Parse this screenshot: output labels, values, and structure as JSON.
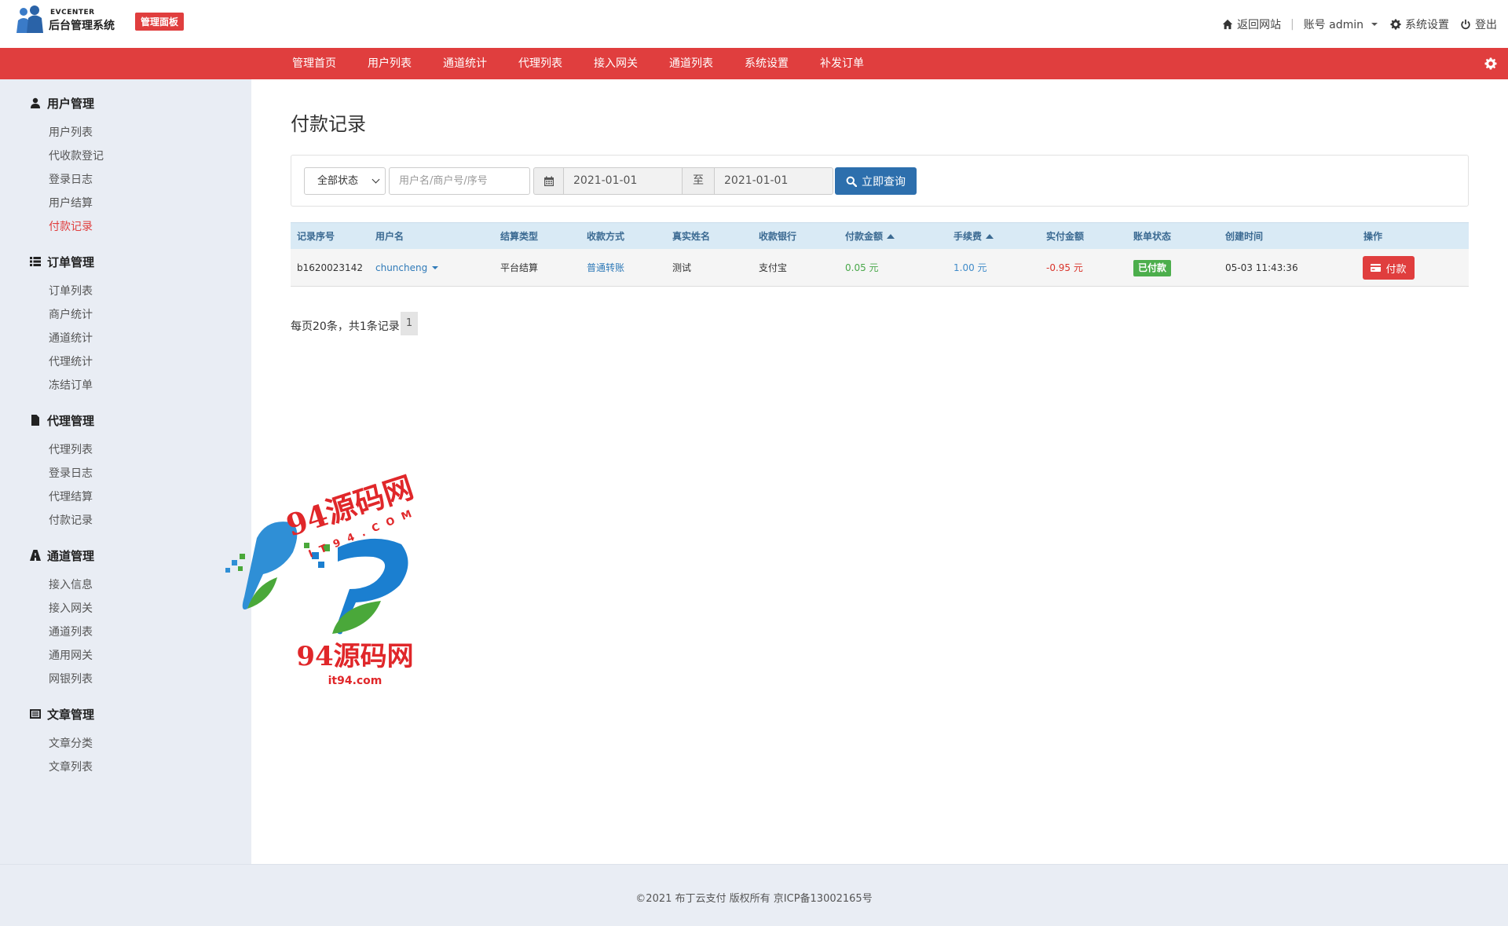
{
  "header": {
    "logo_small": "EVCENTER",
    "logo_big": "后台管理系统",
    "panel_badge": "管理面板",
    "back_site": "返回网站",
    "account": "账号 admin",
    "settings": "系统设置",
    "logout": "登出"
  },
  "nav": {
    "items": [
      "管理首页",
      "用户列表",
      "通道统计",
      "代理列表",
      "接入网关",
      "通道列表",
      "系统设置",
      "补发订单"
    ]
  },
  "sidebar": {
    "groups": [
      {
        "title": "用户管理",
        "icon": "user-icon",
        "items": [
          "用户列表",
          "代收款登记",
          "登录日志",
          "用户结算",
          "付款记录"
        ]
      },
      {
        "title": "订单管理",
        "icon": "list-icon",
        "items": [
          "订单列表",
          "商户统计",
          "通道统计",
          "代理统计",
          "冻结订单"
        ]
      },
      {
        "title": "代理管理",
        "icon": "file-icon",
        "items": [
          "代理列表",
          "登录日志",
          "代理结算",
          "付款记录"
        ]
      },
      {
        "title": "通道管理",
        "icon": "road-icon",
        "items": [
          "接入信息",
          "接入网关",
          "通道列表",
          "通用网关",
          "网银列表"
        ]
      },
      {
        "title": "文章管理",
        "icon": "article-icon",
        "items": [
          "文章分类",
          "文章列表"
        ]
      }
    ],
    "active_item": "付款记录"
  },
  "main": {
    "title": "付款记录",
    "search": {
      "status_selected": "全部状态",
      "keyword_placeholder": "用户名/商户号/序号",
      "date_from": "2021-01-01",
      "to_label": "至",
      "date_to": "2021-01-01",
      "query_button": "立即查询"
    },
    "table": {
      "headers": [
        "记录序号",
        "用户名",
        "结算类型",
        "收款方式",
        "真实姓名",
        "收款银行",
        "付款金额",
        "手续费",
        "实付金额",
        "账单状态",
        "创建时间",
        "操作"
      ],
      "rows": [
        {
          "id": "b1620023142",
          "username": "chuncheng",
          "settle_type": "平台结算",
          "pay_method": "普通转账",
          "real_name": "测试",
          "bank": "支付宝",
          "amount": "0.05 元",
          "fee": "1.00 元",
          "actual": "-0.95 元",
          "status": "已付款",
          "created": "05-03 11:43:36",
          "action": "付款"
        }
      ]
    },
    "pager": {
      "summary": "每页20条，共1条记录",
      "current_page": "1"
    }
  },
  "watermark": {
    "text_top": "94源码网",
    "text_arc": "IT94.COM",
    "text_bottom": "94源码网",
    "text_url": "it94.com"
  },
  "footer": {
    "text": "©2021  布丁云支付 版权所有  京ICP备13002165号"
  },
  "colors": {
    "brand_red": "#e03e3e",
    "query_blue": "#2d6fad",
    "sidebar_bg": "#e9edf4",
    "table_head_bg": "#d9eaf5",
    "paid_green": "#4cae4c"
  }
}
